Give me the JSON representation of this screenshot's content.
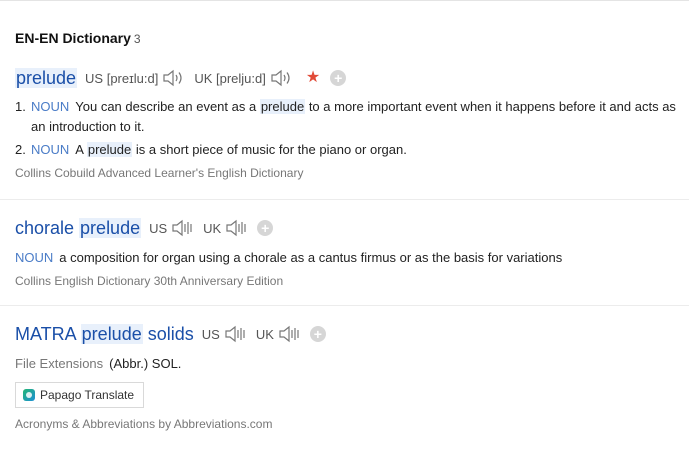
{
  "header": {
    "title": "EN-EN Dictionary",
    "count": "3"
  },
  "entries": [
    {
      "headword_pre": "",
      "headword_hl": "prelude",
      "headword_post": "",
      "us_label": "US [preɪlu:d]",
      "uk_label": "UK [prelju:d]",
      "definitions": [
        {
          "num": "1.",
          "pos": "NOUN",
          "text_before": "You can describe an event as a ",
          "hl": "prelude",
          "text_after": " to a more important event when it happens before it and acts as an introduction to it."
        },
        {
          "num": "2.",
          "pos": "NOUN",
          "text_before": "A ",
          "hl": "prelude",
          "text_after": " is a short piece of music for the piano or organ."
        }
      ],
      "source": "Collins Cobuild Advanced Learner's English Dictionary"
    },
    {
      "headword_pre": "chorale ",
      "headword_hl": "prelude",
      "headword_post": "",
      "us_label": "US",
      "uk_label": "UK",
      "definitions": [
        {
          "pos": "NOUN",
          "text": "a composition for organ using a chorale as a cantus firmus or as the basis for variations"
        }
      ],
      "source": "Collins English Dictionary 30th Anniversary Edition"
    },
    {
      "headword_pre": "MATRA ",
      "headword_hl": "prelude",
      "headword_post": " solids",
      "us_label": "US",
      "uk_label": "UK",
      "definitions": [
        {
          "pos": "File Extensions",
          "text": "(Abbr.) SOL."
        }
      ],
      "papago_label": "Papago Translate",
      "source": "Acronyms & Abbreviations by Abbreviations.com"
    }
  ],
  "colors": {
    "headword": "#1a4fa8",
    "pos": "#4a7cc7",
    "star": "#e14b38",
    "highlight": "#e8f0fb"
  },
  "icons": {
    "speaker": "speaker-icon",
    "star": "star-icon",
    "add": "plus-icon",
    "papago": "papago-icon"
  }
}
